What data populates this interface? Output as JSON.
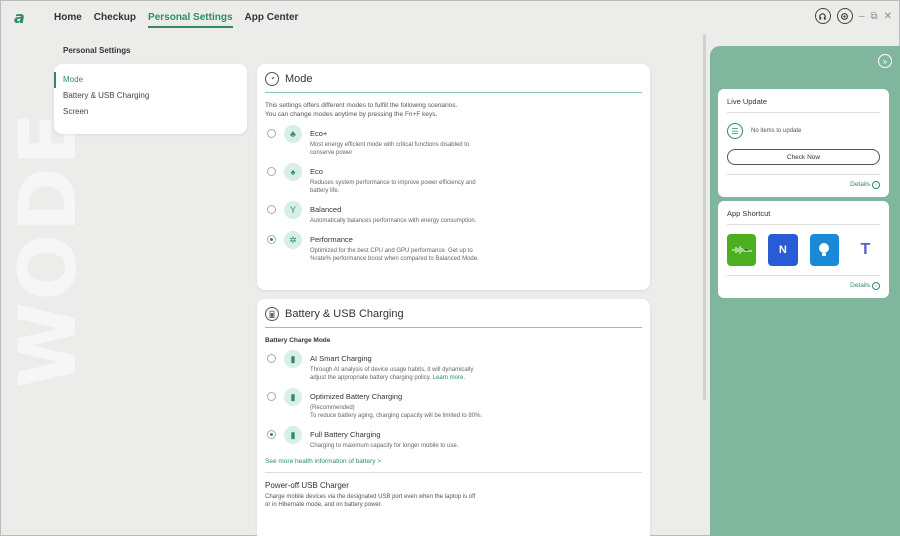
{
  "nav": {
    "logo": "a",
    "items": [
      "Home",
      "Checkup",
      "Personal Settings",
      "App Center"
    ],
    "active_index": 2
  },
  "watermark": "WODE",
  "page_title": "Personal Settings",
  "sidebar": {
    "items": [
      {
        "label": "Mode",
        "active": true
      },
      {
        "label": "Battery & USB Charging",
        "active": false
      },
      {
        "label": "Screen",
        "active": false
      }
    ]
  },
  "mode_card": {
    "title": "Mode",
    "description_line1": "This settings offers different modes to fulfill the following scenarios.",
    "description_line2": "You can change modes anytime by pressing the Fn+F keys.",
    "options": [
      {
        "name": "Eco+",
        "desc1": "Most energy efficient mode with critical functions disabled to",
        "desc2": "conserve power",
        "selected": false
      },
      {
        "name": "Eco",
        "desc1": "Reduces system performance to improve power efficiency and",
        "desc2": "battery life.",
        "selected": false
      },
      {
        "name": "Balanced",
        "desc1": "Automatically balances performance with energy consumption.",
        "desc2": "",
        "selected": false
      },
      {
        "name": "Performance",
        "desc1": "Optimized for the best CPU and GPU performance. Get up to",
        "desc2": "%rate% performance boost when compared to Balanced Mode.",
        "selected": true
      }
    ]
  },
  "battery_card": {
    "title": "Battery & USB Charging",
    "subhead": "Battery Charge Mode",
    "options": [
      {
        "name": "AI Smart Charging",
        "desc1": "Through AI analysis of device usage habits, it will dynamically",
        "desc2": "adjust the appropriate battery charging policy.",
        "link": "Learn more.",
        "selected": false
      },
      {
        "name": "Optimized Battery Charging",
        "desc1": "(Recommended)",
        "desc2": "To reduce battery aging, charging capacity will be limited to 80%.",
        "link": "",
        "selected": false
      },
      {
        "name": "Full Battery Charging",
        "desc1": "Charging to maximum capacity for longer mobile to use.",
        "desc2": "",
        "link": "",
        "selected": true
      }
    ],
    "more_link": "See more health information of battery >",
    "usb_title": "Power-off USB Charger",
    "usb_desc1": "Charge mobile devices via the designated USB port even when the laptop is off",
    "usb_desc2": "or in Hibernate mode, and on battery power."
  },
  "live_update": {
    "title": "Live Update",
    "status": "No items to update",
    "button": "Check Now",
    "details": "Details"
  },
  "app_shortcut": {
    "title": "App Shortcut",
    "apps": [
      {
        "name": "app-1",
        "color": "#4caf1e"
      },
      {
        "name": "app-2",
        "color": "#2a5bd7"
      },
      {
        "name": "app-3",
        "color": "#1a8ad8"
      },
      {
        "name": "teams",
        "color": "#5b5fc7"
      }
    ],
    "details": "Details"
  }
}
